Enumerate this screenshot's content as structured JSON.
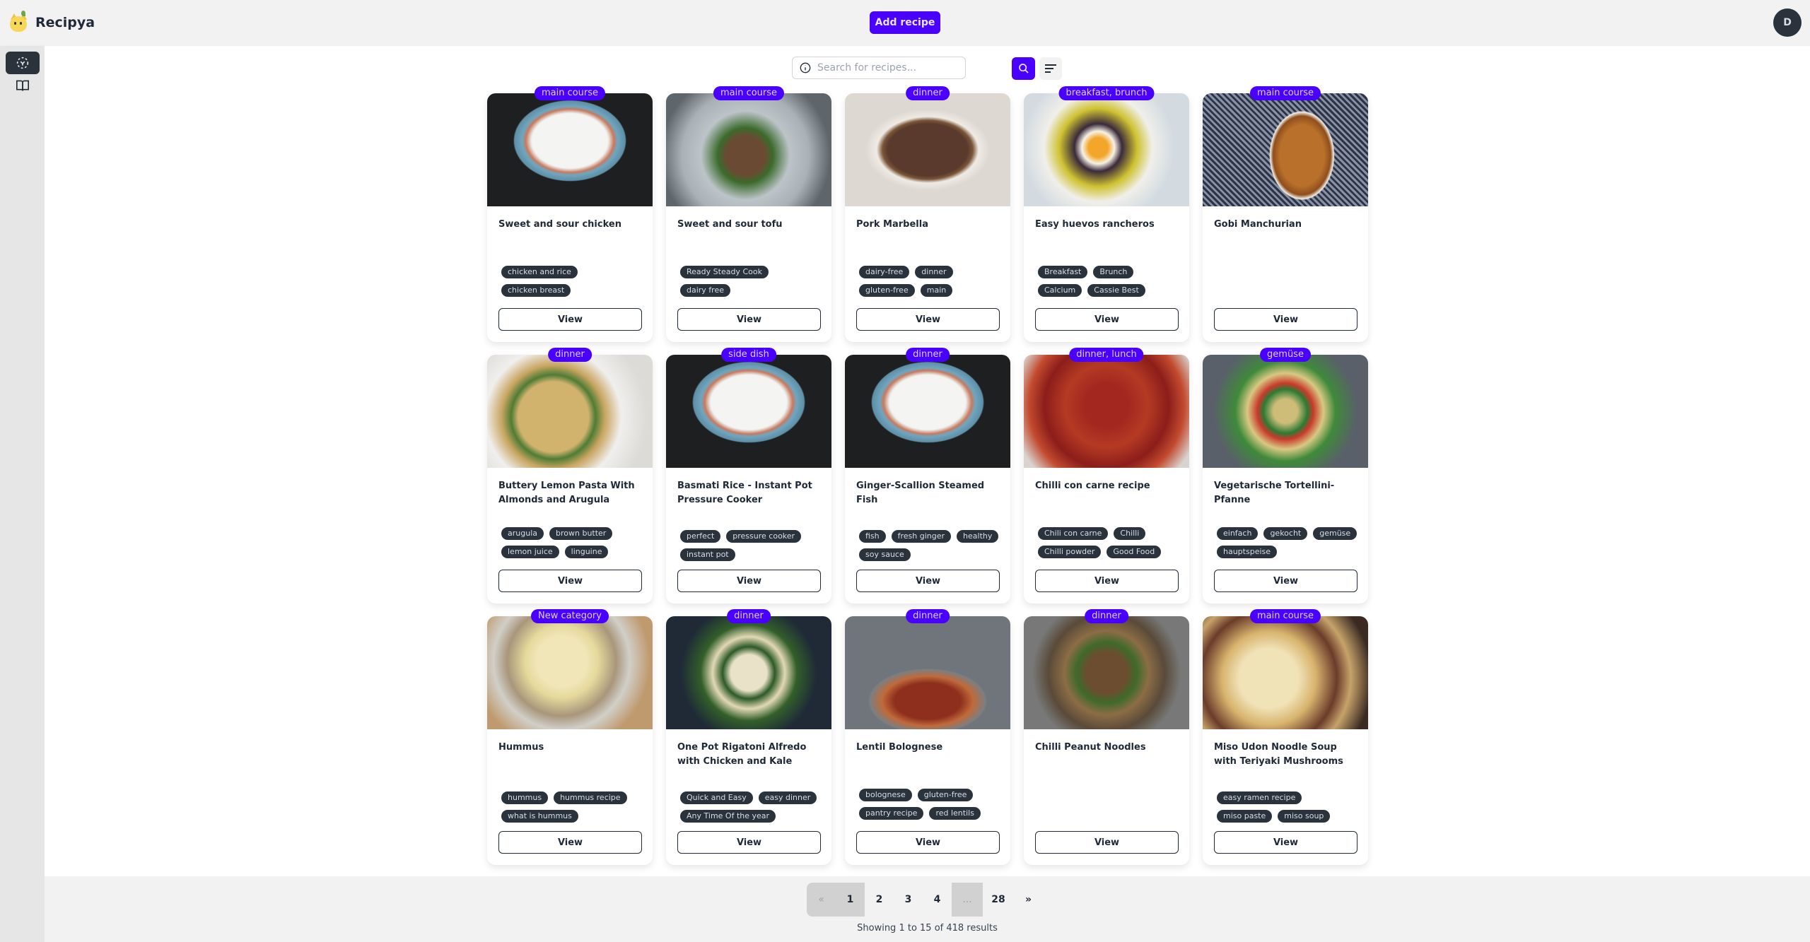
{
  "app": {
    "name": "Recipya"
  },
  "header": {
    "add_recipe_label": "Add recipe",
    "avatar_initial": "D"
  },
  "sidebar": {
    "items": [
      {
        "icon": "scan-icon",
        "active": true
      },
      {
        "icon": "book-icon",
        "active": false
      }
    ]
  },
  "search": {
    "placeholder": "Search for recipes...",
    "value": ""
  },
  "colors": {
    "accent": "#4a00ff",
    "tag_bg": "#2a323c",
    "neutral": "#2a323c"
  },
  "recipes": [
    {
      "category": "main course",
      "title": "Sweet and sour chicken",
      "tags": [
        "chicken and rice",
        "chicken breast"
      ],
      "view_label": "View"
    },
    {
      "category": "main course",
      "title": "Sweet and sour tofu",
      "tags": [
        "Ready Steady Cook",
        "dairy free"
      ],
      "view_label": "View"
    },
    {
      "category": "dinner",
      "title": "Pork Marbella",
      "tags": [
        "dairy-free",
        "dinner",
        "gluten-free",
        "main"
      ],
      "view_label": "View"
    },
    {
      "category": "breakfast, brunch",
      "title": "Easy huevos rancheros",
      "tags": [
        "Breakfast",
        "Brunch",
        "Calcium",
        "Cassie Best"
      ],
      "view_label": "View"
    },
    {
      "category": "main course",
      "title": "Gobi Manchurian",
      "tags": [],
      "view_label": "View"
    },
    {
      "category": "dinner",
      "title": "Buttery Lemon Pasta With Almonds and Arugula",
      "tags": [
        "arugula",
        "brown butter",
        "lemon juice",
        "linguine"
      ],
      "view_label": "View"
    },
    {
      "category": "side dish",
      "title": "Basmati Rice - Instant Pot Pressure Cooker",
      "tags": [
        "perfect",
        "pressure cooker",
        "instant pot"
      ],
      "view_label": "View"
    },
    {
      "category": "dinner",
      "title": "Ginger-Scallion Steamed Fish",
      "tags": [
        "fish",
        "fresh ginger",
        "healthy",
        "soy sauce"
      ],
      "view_label": "View"
    },
    {
      "category": "dinner, lunch",
      "title": "Chilli con carne recipe",
      "tags": [
        "Chili con carne",
        "Chilli",
        "Chilli powder",
        "Good Food"
      ],
      "view_label": "View"
    },
    {
      "category": "gemüse",
      "title": "Vegetarische Tortellini-Pfanne",
      "tags": [
        "einfach",
        "gekocht",
        "gemüse",
        "hauptspeise"
      ],
      "view_label": "View"
    },
    {
      "category": "New category",
      "title": "Hummus",
      "tags": [
        "hummus",
        "hummus recipe",
        "what is hummus"
      ],
      "view_label": "View"
    },
    {
      "category": "dinner",
      "title": "One Pot Rigatoni Alfredo with Chicken and Kale",
      "tags": [
        "Quick and Easy",
        "easy dinner",
        "Any Time Of the year"
      ],
      "view_label": "View"
    },
    {
      "category": "dinner",
      "title": "Lentil Bolognese",
      "tags": [
        "bolognese",
        "gluten-free",
        "pantry recipe",
        "red lentils"
      ],
      "view_label": "View"
    },
    {
      "category": "dinner",
      "title": "Chilli Peanut Noodles",
      "tags": [],
      "view_label": "View"
    },
    {
      "category": "main course",
      "title": "Miso Udon Noodle Soup with Teriyaki Mushrooms",
      "tags": [
        "easy ramen recipe",
        "miso paste",
        "miso soup"
      ],
      "view_label": "View"
    }
  ],
  "pagination": {
    "prev": "«",
    "pages": [
      "1",
      "2",
      "3",
      "4",
      "...",
      "28"
    ],
    "current": "1",
    "next": "»",
    "summary": "Showing 1 to 15 of 418 results"
  }
}
